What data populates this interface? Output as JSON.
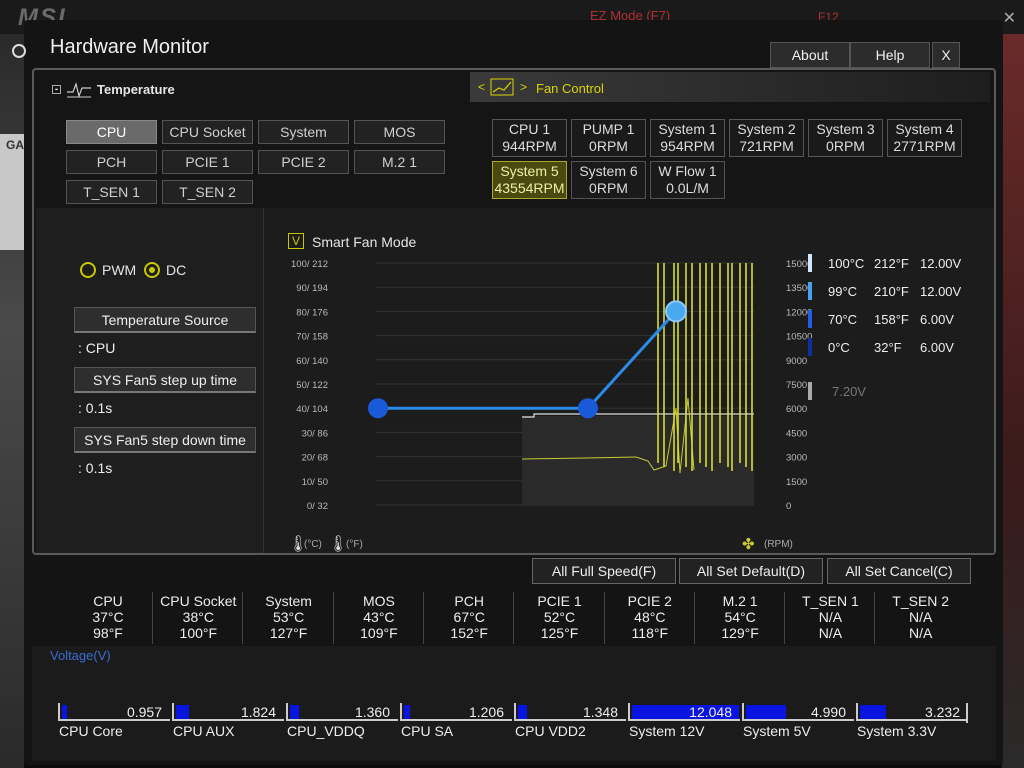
{
  "window": {
    "title": "Hardware Monitor",
    "about": "About",
    "help": "Help",
    "close": "X"
  },
  "tabs": {
    "temperature": "Temperature",
    "fan_control": "Fan Control"
  },
  "background": {
    "ez_mode": "EZ Mode (F7)",
    "f12": "F12",
    "ga": "GA"
  },
  "sensors": [
    {
      "label": "CPU",
      "active": true
    },
    {
      "label": "CPU Socket"
    },
    {
      "label": "System"
    },
    {
      "label": "MOS"
    },
    {
      "label": "PCH"
    },
    {
      "label": "PCIE 1"
    },
    {
      "label": "PCIE 2"
    },
    {
      "label": "M.2 1"
    },
    {
      "label": "T_SEN 1"
    },
    {
      "label": "T_SEN 2"
    }
  ],
  "fans": [
    {
      "name": "CPU 1",
      "rpm": "944RPM"
    },
    {
      "name": "PUMP 1",
      "rpm": "0RPM"
    },
    {
      "name": "System 1",
      "rpm": "954RPM"
    },
    {
      "name": "System 2",
      "rpm": "721RPM"
    },
    {
      "name": "System 3",
      "rpm": "0RPM"
    },
    {
      "name": "System 4",
      "rpm": "2771RPM"
    },
    {
      "name": "System 5",
      "rpm": "43554RPM",
      "active": true
    },
    {
      "name": "System 6",
      "rpm": "0RPM"
    },
    {
      "name": "W Flow 1",
      "rpm": "0.0L/M"
    }
  ],
  "mode": {
    "pwm": "PWM",
    "dc": "DC",
    "selected": "DC"
  },
  "options": {
    "temp_source_label": "Temperature Source",
    "temp_source_value": ": CPU",
    "step_up_label": "SYS Fan5 step up time",
    "step_up_value": ": 0.1s",
    "step_down_label": "SYS Fan5 step down time",
    "step_down_value": ": 0.1s"
  },
  "smart_fan": {
    "label": "Smart Fan Mode",
    "checked": "V"
  },
  "chart_data": {
    "type": "line",
    "left_ticks": [
      "100/ 212",
      "90/ 194",
      "80/ 176",
      "70/ 158",
      "60/ 140",
      "50/ 122",
      "40/ 104",
      "30/  86",
      "20/  68",
      "10/  50",
      "0/  32"
    ],
    "right_ticks": [
      "15000",
      "13500",
      "12000",
      "10500",
      "9000",
      "7500",
      "6000",
      "4500",
      "3000",
      "1500",
      "0"
    ],
    "left_unit": "(°C)",
    "left_unit_f": "(°F)",
    "right_unit": "(RPM)",
    "curve_points": [
      {
        "temp_c": 0,
        "voltage_v": 6.0
      },
      {
        "temp_c": 70,
        "voltage_v": 6.0
      },
      {
        "temp_c": 99,
        "voltage_v": 12.0
      }
    ],
    "curve_color": "#2a8be8",
    "monitor_color": "#d8dc30",
    "ylim_temp": [
      0,
      100
    ],
    "ylim_rpm": [
      0,
      15000
    ]
  },
  "legend": [
    {
      "c": "100°C",
      "f": "212°F",
      "v": "12.00V",
      "color": "#d0e8ff"
    },
    {
      "c": "99°C",
      "f": "210°F",
      "v": "12.00V",
      "color": "#4aa0f0"
    },
    {
      "c": "70°C",
      "f": "158°F",
      "v": "6.00V",
      "color": "#2060e0"
    },
    {
      "c": "0°C",
      "f": "32°F",
      "v": "6.00V",
      "color": "#1030a0"
    }
  ],
  "current_voltage": "7.20V",
  "bottom_buttons": {
    "full_speed": "All Full Speed(F)",
    "set_default": "All Set Default(D)",
    "set_cancel": "All Set Cancel(C)"
  },
  "temps": [
    {
      "name": "CPU",
      "c": "37°C",
      "f": "98°F"
    },
    {
      "name": "CPU Socket",
      "c": "38°C",
      "f": "100°F"
    },
    {
      "name": "System",
      "c": "53°C",
      "f": "127°F"
    },
    {
      "name": "MOS",
      "c": "43°C",
      "f": "109°F"
    },
    {
      "name": "PCH",
      "c": "67°C",
      "f": "152°F"
    },
    {
      "name": "PCIE 1",
      "c": "52°C",
      "f": "125°F"
    },
    {
      "name": "PCIE 2",
      "c": "48°C",
      "f": "118°F"
    },
    {
      "name": "M.2 1",
      "c": "54°C",
      "f": "129°F"
    },
    {
      "name": "T_SEN 1",
      "c": "N/A",
      "f": "N/A"
    },
    {
      "name": "T_SEN 2",
      "c": "N/A",
      "f": "N/A"
    }
  ],
  "voltage_title": "Voltage(V)",
  "voltages": [
    {
      "name": "CPU Core",
      "value": "0.957",
      "fill": 0.05
    },
    {
      "name": "CPU AUX",
      "value": "1.824",
      "fill": 0.12
    },
    {
      "name": "CPU_VDDQ",
      "value": "1.360",
      "fill": 0.08
    },
    {
      "name": "CPU SA",
      "value": "1.206",
      "fill": 0.06
    },
    {
      "name": "CPU VDD2",
      "value": "1.348",
      "fill": 0.08
    },
    {
      "name": "System 12V",
      "value": "12.048",
      "fill": 0.99
    },
    {
      "name": "System 5V",
      "value": "4.990",
      "fill": 0.37
    },
    {
      "name": "System 3.3V",
      "value": "3.232",
      "fill": 0.24
    }
  ]
}
